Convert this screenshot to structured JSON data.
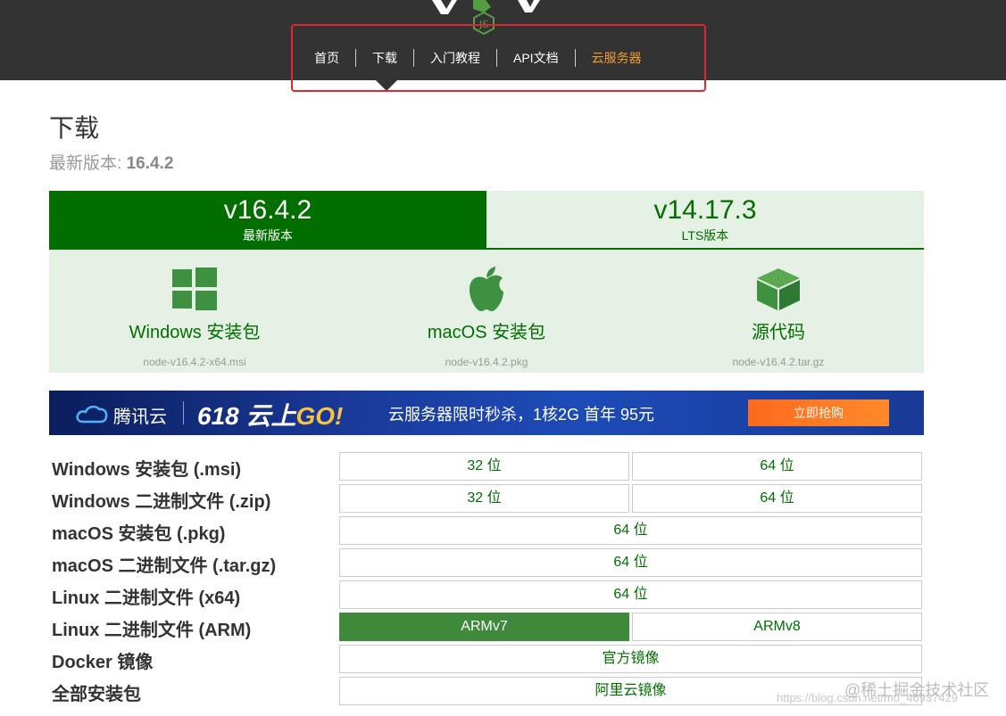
{
  "colors": {
    "header_bg": "#333333",
    "brand_green": "#026e00",
    "panel_bg": "#e4f1e4",
    "accent_orange": "#f39c2e",
    "highlight_red": "#e3262c"
  },
  "nav": {
    "items": [
      {
        "label": "首页"
      },
      {
        "label": "下载"
      },
      {
        "label": "入门教程"
      },
      {
        "label": "API文档"
      },
      {
        "label": "云服务器"
      }
    ],
    "active_index": 1
  },
  "page": {
    "title": "下载",
    "latest_label": "最新版本: ",
    "latest_version": "16.4.2"
  },
  "versions": {
    "current": {
      "version": "v16.4.2",
      "label": "最新版本"
    },
    "lts": {
      "version": "v14.17.3",
      "label": "LTS版本"
    }
  },
  "downloads": [
    {
      "icon": "windows-icon",
      "label": "Windows 安装包",
      "file": "node-v16.4.2-x64.msi"
    },
    {
      "icon": "apple-icon",
      "label": "macOS 安装包",
      "file": "node-v16.4.2.pkg"
    },
    {
      "icon": "box-icon",
      "label": "源代码",
      "file": "node-v16.4.2.tar.gz"
    }
  ],
  "banner": {
    "brand": "腾讯云",
    "promo_618": "618 云上",
    "promo_go": "GO!",
    "offer": "云服务器限时秒杀，1核2G 首年 95元",
    "cta": "立即抢购"
  },
  "table": {
    "rows": [
      {
        "label": "Windows 安装包 (.msi)",
        "cells": [
          "32 位",
          "64 位"
        ]
      },
      {
        "label": "Windows 二进制文件 (.zip)",
        "cells": [
          "32 位",
          "64 位"
        ]
      },
      {
        "label": "macOS 安装包 (.pkg)",
        "cells": [
          "64 位"
        ]
      },
      {
        "label": "macOS 二进制文件 (.tar.gz)",
        "cells": [
          "64 位"
        ]
      },
      {
        "label": "Linux 二进制文件 (x64)",
        "cells": [
          "64 位"
        ]
      },
      {
        "label": "Linux 二进制文件 (ARM)",
        "cells": [
          "ARMv7",
          "ARMv8"
        ]
      },
      {
        "label": "Docker 镜像",
        "cells": [
          "官方镜像"
        ]
      },
      {
        "label": "全部安装包",
        "cells": [
          "阿里云镜像"
        ]
      }
    ]
  },
  "watermark": {
    "site": "@稀土掘金技术社区",
    "url": "https://blog.csdn.net/m0_46937429"
  }
}
